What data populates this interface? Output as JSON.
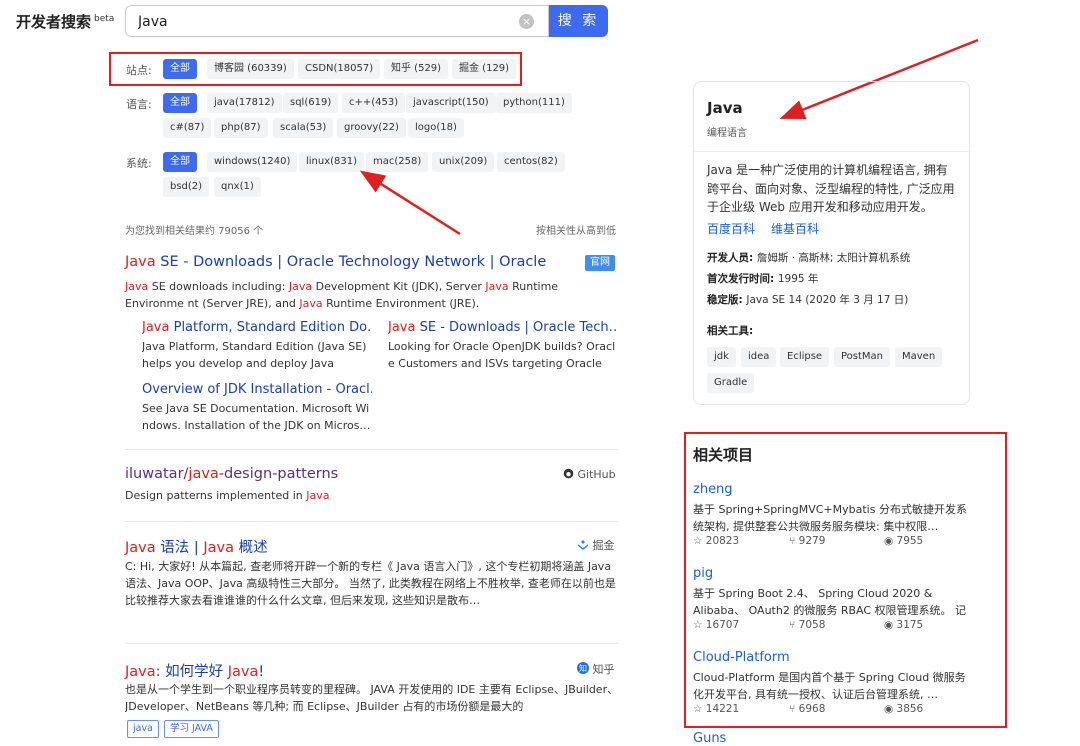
{
  "header": {
    "logo": "开发者搜索",
    "logo_badge": "beta",
    "search_value": "Java",
    "clear_icon": "×",
    "search_button": "搜 索"
  },
  "filters": {
    "site": {
      "label": "站点:",
      "chips": [
        "全部",
        "博客园 (60339)",
        "CSDN(18057)",
        "知乎 (529)",
        "掘金 (129)"
      ]
    },
    "language": {
      "label": "语言:",
      "chips": [
        "全部",
        "java(17812)",
        "sql(619)",
        "c++(453)",
        "javascript(150)",
        "python(111)",
        "c#(87)",
        "php(87)",
        "scala(53)",
        "groovy(22)",
        "logo(18)"
      ]
    },
    "system": {
      "label": "系统:",
      "chips": [
        "全部",
        "windows(1240)",
        "linux(831)",
        "mac(258)",
        "unix(209)",
        "centos(82)",
        "bsd(2)",
        "qnx(1)"
      ]
    }
  },
  "results_meta": {
    "count_text": "为您找到相关结果约 79056 个",
    "sort_text": "按相关性从高到低"
  },
  "results": [
    {
      "title_parts": [
        "Java",
        " SE - Downloads | Oracle Technology Network | Oracle"
      ],
      "badge": "官网",
      "desc_parts": [
        "",
        "Java",
        " SE downloads including: ",
        "Java",
        " Development Kit (JDK), Server ",
        "Java",
        " Runtime Environme nt (Server JRE), and ",
        "Java",
        " Runtime Environment (JRE)."
      ],
      "sublinks": [
        {
          "title_parts": [
            "Java",
            " Platform, Standard Edition Do…"
          ],
          "desc": "Java Platform, Standard Edition (Java SE) helps you develop and deploy Java appli…"
        },
        {
          "title_parts": [
            "Java",
            " SE - Downloads | Oracle Tech…"
          ],
          "desc": "Looking for Oracle OpenJDK builds? Oracl e Customers and ISVs targeting Oracle L…"
        },
        {
          "title_parts": [
            "",
            "Overview of JDK Installation - Oracl…"
          ],
          "desc": "See Java SE Documentation. Microsoft Wi ndows. Installation of the JDK on Micros…"
        }
      ]
    },
    {
      "title_parts": [
        "iluwatar/",
        "java",
        "-design-patterns"
      ],
      "source": "GitHub",
      "desc_parts": [
        "Design patterns implemented in ",
        "Java"
      ]
    },
    {
      "title_parts": [
        "Java",
        " 语法 | ",
        "Java",
        " 概述"
      ],
      "source": "掘金",
      "desc": "C: Hi, 大家好! 从本篇起, 查老师将开辟一个新的专栏《 Java 语言入门》, 这个专栏初期将涵盖 Java 语法、Java OOP、Java 高级特性三大部分。 当然了, 此类教程在网络上不胜枚举, 查老师在以前也是比较推荐大家去看谁谁谁的什么什么文章, 但后来发现, 这些知识是散布…"
    },
    {
      "title_parts": [
        "Java",
        ": 如何学好 ",
        "Java",
        "!"
      ],
      "source": "知乎",
      "desc": "也是从一个学生到一个职业程序员转变的里程碑。 JAVA 开发使用的 IDE 主要有 Eclipse、JBuilder、JDeveloper、NetBeans 等几种; 而 Eclipse、JBuilder 占有的市场份额是最大的",
      "tags": [
        "java",
        "学习 JAVA"
      ]
    }
  ],
  "knowledge_card": {
    "title": "Java",
    "subtitle": "编程语言",
    "description": "Java 是一种广泛使用的计算机编程语言, 拥有跨平台、面向对象、泛型编程的特性, 广泛应用于企业级 Web 应用开发和移动应用开发。",
    "links": [
      "百度百科",
      "维基百科"
    ],
    "facts": [
      {
        "key": "开发人员:",
        "value": "詹姆斯 · 高斯林; 太阳计算机系统"
      },
      {
        "key": "首次发行时间:",
        "value": "1995 年"
      },
      {
        "key": "稳定版:",
        "value": "Java SE 14 (2020 年 3 月 17 日)"
      }
    ],
    "tools_label": "相关工具:",
    "tools": [
      "jdk",
      "idea",
      "Eclipse",
      "PostMan",
      "Maven",
      "Gradle"
    ]
  },
  "related_projects": {
    "title": "相关项目",
    "items": [
      {
        "name": "zheng",
        "desc": "基于 Spring+SpringMVC+Mybatis 分布式敏捷开发系统架构, 提供整套公共微服务服务模块: 集中权限…",
        "stars": "20823",
        "forks": "9279",
        "views": "7955"
      },
      {
        "name": "pig",
        "desc": "基于 Spring Boot 2.4、 Spring Cloud 2020 & Alibaba、 OAuth2 的微服务 RBAC 权限管理系统。 记得…",
        "stars": "16707",
        "forks": "7058",
        "views": "3175"
      },
      {
        "name": "Cloud-Platform",
        "desc": "Cloud-Platform 是国内首个基于 Spring Cloud 微服务化开发平台, 具有统一授权、认证后台管理系统, …",
        "stars": "14221",
        "forks": "6968",
        "views": "3856"
      }
    ],
    "next_partial": "Guns"
  },
  "colors": {
    "accent": "#3e6af0",
    "highlight": "#e0201c",
    "annotation": "#e02020",
    "link": "#1a3fa8"
  }
}
